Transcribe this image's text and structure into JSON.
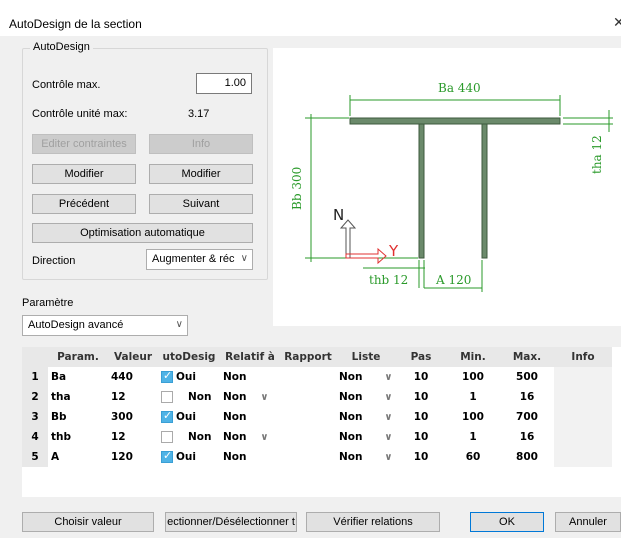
{
  "window": {
    "title": "AutoDesign de la section",
    "close_glyph": "✕"
  },
  "autodesign": {
    "group_label": "AutoDesign",
    "controle_max_label": "Contrôle max.",
    "controle_max_value": "1.00",
    "controle_unite_label": "Contrôle unité max:",
    "controle_unite_value": "3.17",
    "editer_label": "Editer contraintes",
    "info_label": "Info",
    "modifier_left_label": "Modifier",
    "modifier_right_label": "Modifier",
    "precedent_label": "Précédent",
    "suivant_label": "Suivant",
    "optimisation_label": "Optimisation automatique",
    "direction_label": "Direction",
    "direction_value": "Augmenter & réc"
  },
  "parametre": {
    "label": "Paramètre",
    "selected": "AutoDesign avancé"
  },
  "drawing": {
    "label_Ba": "Ba 440",
    "label_tha": "tha 12",
    "label_Bb": "Bb 300",
    "label_thb": "thb 12",
    "label_A": "A 120",
    "axis_z": "N",
    "axis_y": "Y"
  },
  "table": {
    "columns": [
      "",
      "Param.",
      "Valeur",
      "utoDesig",
      "Relatif à",
      "Rapport",
      "Liste",
      "Pas",
      "Min.",
      "Max.",
      "Info"
    ],
    "rows": [
      {
        "num": "1",
        "param": "Ba",
        "valeur": "440",
        "auto": true,
        "auto_label": "Oui",
        "relatif": "Non",
        "relatif_dd": false,
        "rapport": "",
        "liste": "Non",
        "pas": "10",
        "min": "100",
        "max": "500"
      },
      {
        "num": "2",
        "param": "tha",
        "valeur": "12",
        "auto": false,
        "auto_label": "Non",
        "relatif": "Non",
        "relatif_dd": true,
        "rapport": "",
        "liste": "Non",
        "pas": "10",
        "min": "1",
        "max": "16"
      },
      {
        "num": "3",
        "param": "Bb",
        "valeur": "300",
        "auto": true,
        "auto_label": "Oui",
        "relatif": "Non",
        "relatif_dd": false,
        "rapport": "",
        "liste": "Non",
        "pas": "10",
        "min": "100",
        "max": "700"
      },
      {
        "num": "4",
        "param": "thb",
        "valeur": "12",
        "auto": false,
        "auto_label": "Non",
        "relatif": "Non",
        "relatif_dd": true,
        "rapport": "",
        "liste": "Non",
        "pas": "10",
        "min": "1",
        "max": "16"
      },
      {
        "num": "5",
        "param": "A",
        "valeur": "120",
        "auto": true,
        "auto_label": "Oui",
        "relatif": "Non",
        "relatif_dd": false,
        "rapport": "",
        "liste": "Non",
        "pas": "10",
        "min": "60",
        "max": "800"
      }
    ]
  },
  "bottom": {
    "choisir_label": "Choisir valeur",
    "selectionner_label": "ectionner/Désélectionner t",
    "verifier_label": "Vérifier relations",
    "ok_label": "OK",
    "annuler_label": "Annuler"
  },
  "colors": {
    "section": "#6b8a6b",
    "dim": "#2a9a2a",
    "axis_y": "#e03030"
  }
}
